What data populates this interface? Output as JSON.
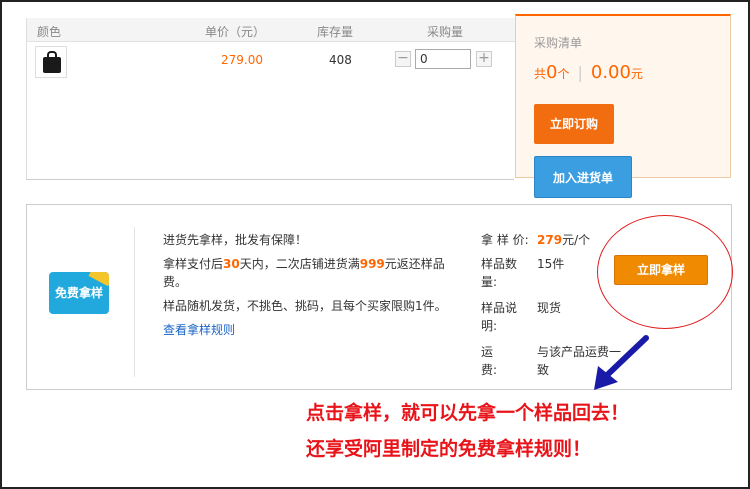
{
  "table": {
    "headers": [
      "颜色",
      "单价（元）",
      "库存量",
      "采购量"
    ],
    "row": {
      "price": "279.00",
      "stock": "408",
      "qty_value": "0",
      "minus": "−",
      "plus": "+"
    }
  },
  "cart": {
    "title": "采购清单",
    "prefix": "共",
    "count": "0",
    "count_unit": "个",
    "divider": "|",
    "total": "0.00",
    "total_unit": "元",
    "order_button": "立即订购",
    "add_button": "加入进货单"
  },
  "sample": {
    "badge_label": "免费拿样",
    "line1": "进货先拿样，批发有保障！",
    "line2_a": "拿样支付后",
    "line2_days": "30",
    "line2_b": "天内，二次店铺进货满",
    "line2_amount": "999",
    "line2_c": "元返还样品费。",
    "line3": "样品随机发货，不挑色、挑码，且每个买家限购1件。",
    "rules_link": "查看拿样规则",
    "price_label": "拿 样 价:",
    "price_value": "279",
    "price_unit": "元/个",
    "qty_label": "样品数量:",
    "qty_value": "15件",
    "desc_label": "样品说明:",
    "desc_value": "现货",
    "ship_label": "运　　费:",
    "ship_value": "与该产品运费一致",
    "button": "立即拿样"
  },
  "annotation": {
    "line1": "点击拿样，就可以先拿一个样品回去！",
    "line2": "还享受阿里制定的免费拿样规则！",
    "color": "#e8141a"
  }
}
